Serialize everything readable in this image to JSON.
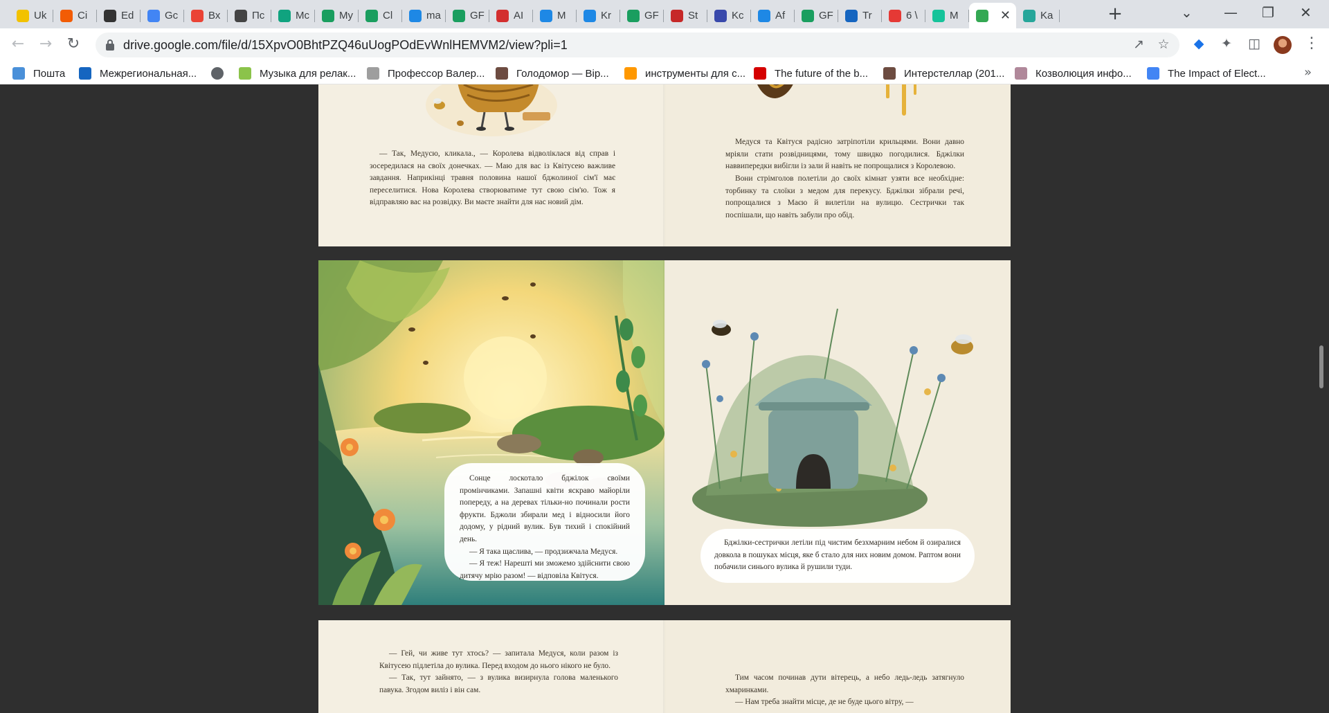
{
  "tabs": [
    {
      "label": "Uk",
      "icon": "yellow-circle-icon",
      "color": "#f2c200"
    },
    {
      "label": "Ci",
      "icon": "sun-icon",
      "color": "#f25c05"
    },
    {
      "label": "Ed",
      "icon": "edu-crest-icon",
      "color": "#333333"
    },
    {
      "label": "Gc",
      "icon": "google-translate-icon",
      "color": "#4285f4"
    },
    {
      "label": "Вх",
      "icon": "gmail-icon",
      "color": "#ea4335"
    },
    {
      "label": "Пс",
      "icon": "trident-icon",
      "color": "#444444"
    },
    {
      "label": "Mc",
      "icon": "openai-icon",
      "color": "#10a37f"
    },
    {
      "label": "My",
      "icon": "gf-icon",
      "color": "#1a9e5f"
    },
    {
      "label": "Cl",
      "icon": "gf-icon",
      "color": "#1a9e5f"
    },
    {
      "label": "ma",
      "icon": "grid-icon",
      "color": "#1e88e5"
    },
    {
      "label": "GF",
      "icon": "gf-icon",
      "color": "#1a9e5f"
    },
    {
      "label": "AI",
      "icon": "bars-icon",
      "color": "#d32f2f"
    },
    {
      "label": "M",
      "icon": "grid-icon",
      "color": "#1e88e5"
    },
    {
      "label": "Kr",
      "icon": "grid-icon",
      "color": "#1e88e5"
    },
    {
      "label": "GF",
      "icon": "gf-icon",
      "color": "#1a9e5f"
    },
    {
      "label": "St",
      "icon": "ua-flag-icon",
      "color": "#c62828"
    },
    {
      "label": "Kc",
      "icon": "dots-icon",
      "color": "#3949ab"
    },
    {
      "label": "Af",
      "icon": "grid-icon",
      "color": "#1e88e5"
    },
    {
      "label": "GF",
      "icon": "gf-icon",
      "color": "#1a9e5f"
    },
    {
      "label": "Tr",
      "icon": "swirl-icon",
      "color": "#1565c0"
    },
    {
      "label": "6 \\",
      "icon": "molecule-icon",
      "color": "#e53935"
    },
    {
      "label": "M",
      "icon": "grammarly-icon",
      "color": "#15c39a"
    },
    {
      "label": "",
      "icon": "google-drive-icon",
      "color": "#34a853",
      "active": true
    },
    {
      "label": "Ka",
      "icon": "gear-badge-icon",
      "color": "#26a69a"
    }
  ],
  "address": {
    "url": "drive.google.com/file/d/15XpvO0BhtPZQ46uUogPOdEvWnlHEMVM2/view?pli=1"
  },
  "bookmarks": [
    {
      "label": "Пошта",
      "icon": "mail-icon",
      "color": "#4a90d9"
    },
    {
      "label": "Межрегиональная...",
      "icon": "chart-logo-icon",
      "color": "#1565c0"
    },
    {
      "label": "",
      "icon": "globe-icon",
      "color": "#5f6368"
    },
    {
      "label": "Музыка для релак...",
      "icon": "android-icon",
      "color": "#8bc34a"
    },
    {
      "label": "Профессор Валер...",
      "icon": "page-icon",
      "color": "#9e9e9e"
    },
    {
      "label": "Голодомор — Вір...",
      "icon": "bird-icon",
      "color": "#6d4c41"
    },
    {
      "label": "инструменты для с...",
      "icon": "cup-icon",
      "color": "#ff9800"
    },
    {
      "label": "The future of the b...",
      "icon": "e-logo-icon",
      "color": "#d50000"
    },
    {
      "label": "Интерстеллар (201...",
      "icon": "mask-icon",
      "color": "#6d4c41"
    },
    {
      "label": "Козволюция инфо...",
      "icon": "frame-icon",
      "color": "#b0889a"
    },
    {
      "label": "The Impact of Elect...",
      "icon": "google-icon",
      "color": "#4285f4"
    }
  ],
  "book": {
    "spread1": {
      "left_text": "— Так, Медусю, кликала., — Королева відволіклася від справ і зосередилася на своїх донечках. — Маю для вас із Квітусею важливе завдання. Наприкінці травня половина нашої бджолиної сім'ї має переселитися. Нова Королева створюватиме тут свою сім'ю. Тож я відправляю вас на розвідку. Ви маєте знайти для нас новий дім.",
      "right_text_1": "Медуся та Квітуся радісно затріпотіли крильцями. Вони давно мріяли стати розвідницями, тому швидко погодилися. Бджілки наввипередки вибігли із зали й навіть не попрощалися з Королевою.",
      "right_text_2": "Вони стрімголов полетіли до своїх кімнат узяти все необхідне: торбинку та слоїки з медом для перекусу. Бджілки зібрали речі, попрощалися з Маєю й вилетіли на вулицю. Сестрички так поспішали, що навіть забули про обід."
    },
    "spread2": {
      "left_bubble": [
        "Сонце лоскотало бджілок своїми промінчиками. Запашні квіти яскраво майоріли попереду, а на деревах тільки-но починали рости фрукти. Бджоли збирали мед і відносили його додому, у рідний вулик. Був тихий і спокійний день.",
        "— Я така щаслива, — продзижчала Медуся.",
        "— Я теж! Нарешті ми зможемо здійснити свою дитячу мрію разом! — відповіла Квітуся."
      ],
      "right_bubble": "Бджілки-сестрички летіли під чистим безхмарним небом й озиралися довкола в пошуках місця, яке б стало для них новим домом. Раптом вони побачили синього вулика й рушили туди."
    },
    "spread3": {
      "left_text": [
        "— Гей, чи живе тут хтось? — запитала Медуся, коли разом із Квітусею підлетіла до вулика. Перед входом до нього нікого не було.",
        "— Так, тут зайнято, — з вулика визирнула голова маленького павука. Згодом виліз і він сам."
      ],
      "right_text": [
        "Тим часом починав дути вітерець, а небо ледь-ледь затягнуло хмаринками.",
        "— Нам треба знайти місце, де не буде цього вітру, —"
      ]
    }
  }
}
